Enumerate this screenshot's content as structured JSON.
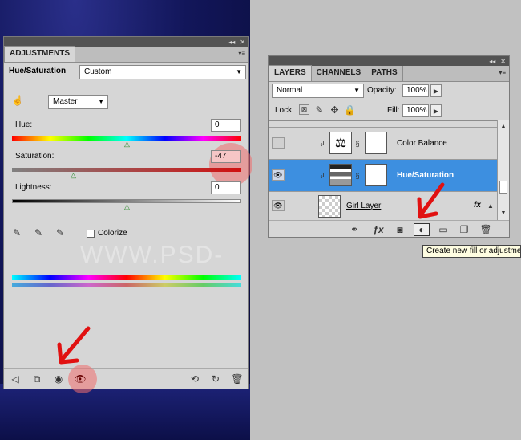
{
  "adjustments": {
    "tab": "ADJUSTMENTS",
    "preset_label": "Hue/Saturation",
    "preset_value": "Custom",
    "channel_value": "Master",
    "hue_label": "Hue:",
    "hue_value": "0",
    "saturation_label": "Saturation:",
    "saturation_value": "-47",
    "lightness_label": "Lightness:",
    "lightness_value": "0",
    "colorize_label": "Colorize",
    "watermark": "WWW.PSD-"
  },
  "layers": {
    "tabs": [
      "LAYERS",
      "CHANNELS",
      "PATHS"
    ],
    "blend_mode": "Normal",
    "opacity_label": "Opacity:",
    "opacity_value": "100%",
    "lock_label": "Lock:",
    "fill_label": "Fill:",
    "fill_value": "100%",
    "rows": [
      {
        "name": "Color Balance"
      },
      {
        "name": "Hue/Saturation"
      },
      {
        "name": "Girl Layer"
      }
    ],
    "fx_label": "fx"
  },
  "tooltip": "Create new fill or adjustment layer",
  "colors": {
    "selected_row": "#3d8fe0",
    "annotation_red": "#e11111",
    "highlight_circle": "#f06e6e"
  },
  "icons": [
    "hand-adjust-icon",
    "eyedropper-icon",
    "eyedropper-plus-icon",
    "eyedropper-minus-icon",
    "back-arrow-icon",
    "clip-layer-icon",
    "visibility-eye-icon",
    "reset-icon",
    "refresh-icon",
    "trash-icon",
    "link-icon",
    "fx-icon",
    "mask-icon",
    "adjustment-layer-icon",
    "group-folder-icon",
    "new-layer-icon",
    "chain-link-icon",
    "scale-balance-icon"
  ]
}
